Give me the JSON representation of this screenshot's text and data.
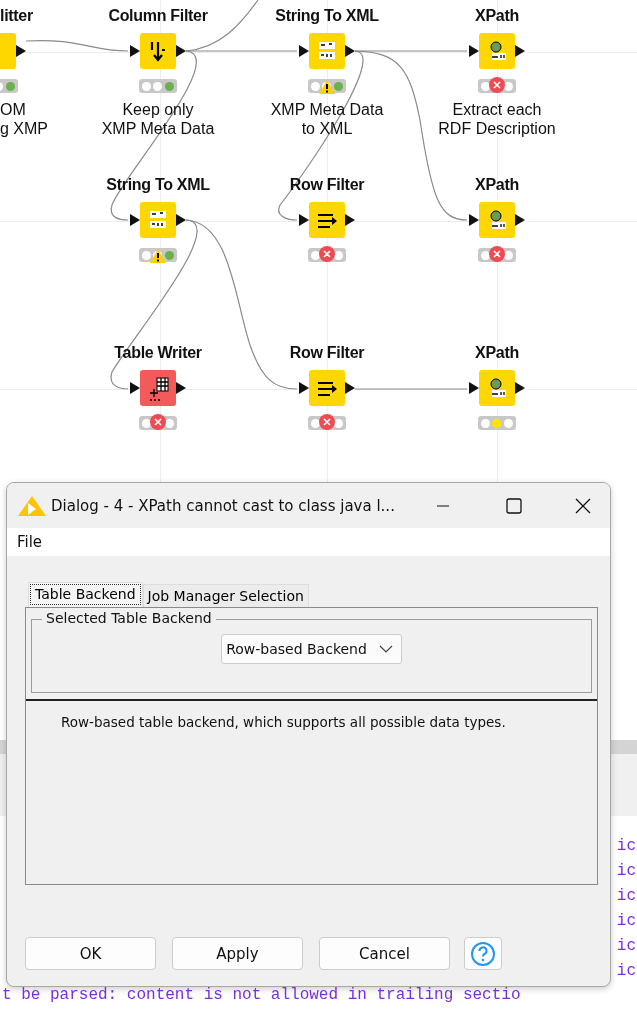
{
  "workflow": {
    "nodes": [
      {
        "label": "litter",
        "kind": "splitter",
        "color": "#ffd700",
        "executed": true,
        "error": false,
        "warning": false,
        "annotation": [
          "OM",
          "g XMP"
        ]
      },
      {
        "label": "Column Filter",
        "kind": "columnfilter",
        "color": "#ffd700",
        "executed": true,
        "error": false,
        "warning": false,
        "annotation": [
          "Keep only",
          "XMP Meta Data"
        ]
      },
      {
        "label": "String To XML",
        "kind": "converter",
        "color": "#ffd700",
        "executed": true,
        "error": false,
        "warning": true,
        "annotation": [
          "XMP Meta Data",
          "to XML"
        ]
      },
      {
        "label": "XPath",
        "kind": "xpath",
        "color": "#ffd700",
        "executed": false,
        "error": true,
        "warning": false,
        "annotation": [
          "Extract each",
          "RDF Description"
        ]
      },
      {
        "label": "String To XML",
        "kind": "converter",
        "color": "#ffd700",
        "executed": true,
        "error": false,
        "warning": true
      },
      {
        "label": "Row Filter",
        "kind": "rowfilter",
        "color": "#ffd700",
        "executed": false,
        "error": true,
        "warning": false
      },
      {
        "label": "XPath",
        "kind": "xpath",
        "color": "#ffd700",
        "executed": false,
        "error": true,
        "warning": false
      },
      {
        "label": "Table Writer",
        "kind": "writer",
        "color": "#f35b5b",
        "executed": false,
        "error": true,
        "warning": false
      },
      {
        "label": "Row Filter",
        "kind": "rowfilter",
        "color": "#ffd700",
        "executed": false,
        "error": true,
        "warning": false
      },
      {
        "label": "XPath",
        "kind": "xpath",
        "color": "#ffd700",
        "executed": false,
        "error": false,
        "warning": false
      }
    ]
  },
  "console": {
    "lines": [
      "ic",
      "ic",
      "ic",
      "ic",
      "ic",
      "ic"
    ],
    "last_line": "t be parsed: content is not allowed in trailing sectio"
  },
  "dialog": {
    "title": "Dialog - 4 - XPath cannot cast to class java l...",
    "menu": [
      "File"
    ],
    "tabs": [
      {
        "label": "Table Backend",
        "selected": true
      },
      {
        "label": "Job Manager Selection",
        "selected": false
      }
    ],
    "group": {
      "legend": "Selected Table Backend",
      "value": "Row-based Backend"
    },
    "description": "Row-based table backend, which supports all possible data types.",
    "buttons": [
      "OK",
      "Apply",
      "Cancel"
    ]
  }
}
